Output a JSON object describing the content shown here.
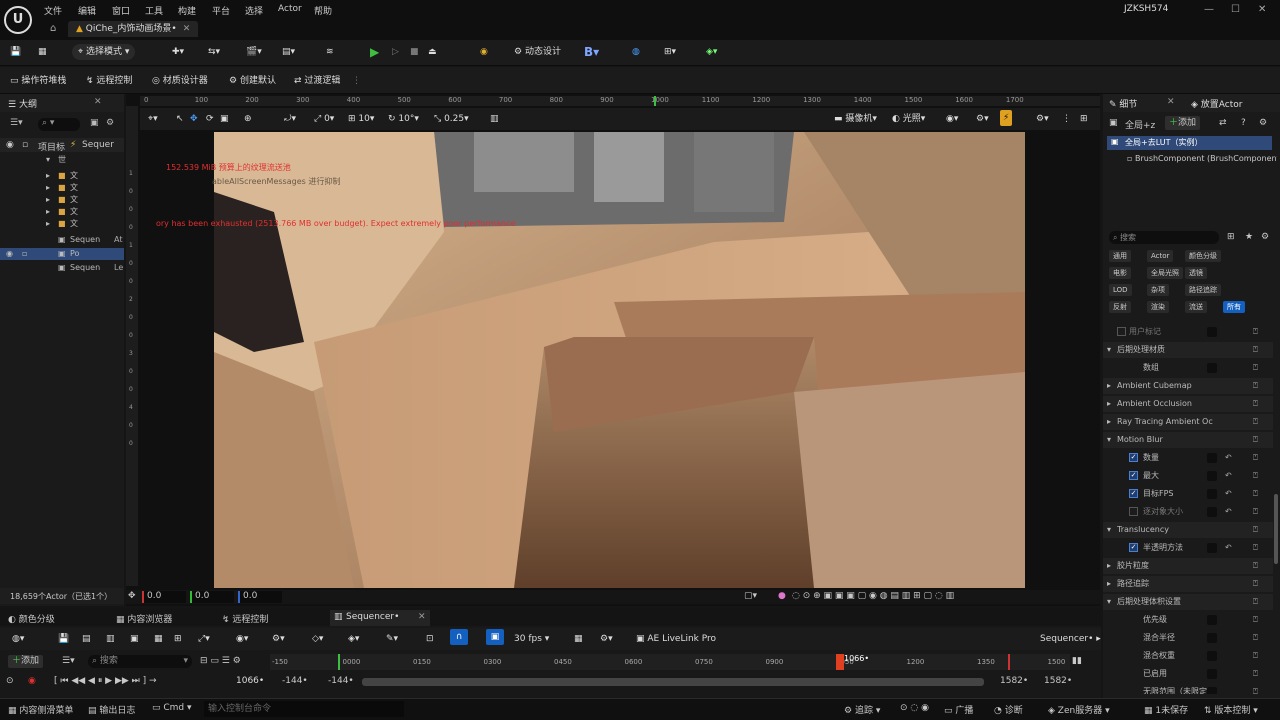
{
  "app": {
    "menus": [
      "文件",
      "编辑",
      "窗口",
      "工具",
      "构建",
      "平台",
      "选择",
      "Actor",
      "帮助"
    ],
    "user": "JZKSH574",
    "level_tab": "QiChe_内饰动画场景•"
  },
  "toolbar": {
    "mode": "选择模式",
    "dynamic": "动态设计"
  },
  "toolbar2": [
    "操作符堆栈",
    "远程控制",
    "材质设计器",
    "创建默认",
    "过渡逻辑"
  ],
  "outliner": {
    "title": "大纲",
    "col_label": "项目标",
    "col_type": "Sequer",
    "items": [
      {
        "label": "世",
        "indent": 3
      },
      {
        "label": "文",
        "indent": 4
      },
      {
        "label": "文",
        "indent": 4
      },
      {
        "label": "文",
        "indent": 4
      },
      {
        "label": "文",
        "indent": 4
      },
      {
        "label": "文",
        "indent": 4
      },
      {
        "label": "Sequen",
        "indent": 4,
        "type": "At"
      },
      {
        "label": "Po",
        "indent": 4,
        "selected": true
      },
      {
        "label": "Sequen",
        "indent": 4,
        "type": "Le"
      }
    ],
    "footer": "18,659个Actor（已选1个）"
  },
  "viewport": {
    "ruler": [
      "0",
      "100",
      "200",
      "300",
      "400",
      "500",
      "600",
      "700",
      "800",
      "900",
      "1000",
      "1100",
      "1200",
      "1300",
      "1400",
      "1500",
      "1600",
      "1700"
    ],
    "left_ruler": [
      "1",
      "0",
      "0",
      "0",
      "1",
      "0",
      "0",
      "2",
      "0",
      "0",
      "3",
      "0",
      "0",
      "4",
      "0",
      "0"
    ],
    "tools": {
      "grid": "0",
      "angle": "10",
      "rot": "10°",
      "scale": "0.25"
    },
    "camera": "摄像机",
    "lighting": "光照",
    "msg1": "152.539 MiB 预算上的纹理流送池",
    "msg2": "ableAllScreenMessages 进行抑制",
    "msg3": "ory has been exhausted (2513.766 MB over budget). Expect extremely poor performance",
    "coords": [
      "0.0",
      "0.0",
      "0.0"
    ]
  },
  "details": {
    "tab1": "细节",
    "tab2": "放置Actor",
    "component_label": "全局+z",
    "add": "添加",
    "actor": "全局+去LUT（实例）",
    "brush": "BrushComponent (BrushComponent)",
    "search": "搜索",
    "filters": [
      [
        "通用",
        "Actor",
        "颜色分级"
      ],
      [
        "电影",
        "全局光照",
        "透镜"
      ],
      [
        "LOD",
        "杂项",
        "路径追踪"
      ],
      [
        "反射",
        "渲染",
        "流送",
        "所有"
      ]
    ],
    "props": [
      {
        "label": "用户标记",
        "type": "item"
      },
      {
        "label": "后期处理材质",
        "type": "group"
      },
      {
        "label": "数组",
        "type": "item"
      },
      {
        "label": "Ambient Cubemap",
        "type": "group-closed"
      },
      {
        "label": "Ambient Occlusion",
        "type": "group-closed"
      },
      {
        "label": "Ray Tracing Ambient Oc",
        "type": "group-closed"
      },
      {
        "label": "Motion Blur",
        "type": "group"
      },
      {
        "label": "数量",
        "type": "check"
      },
      {
        "label": "最大",
        "type": "check"
      },
      {
        "label": "目标FPS",
        "type": "check"
      },
      {
        "label": "逐对象大小",
        "type": "check-off"
      },
      {
        "label": "Translucency",
        "type": "group"
      },
      {
        "label": "半透明方法",
        "type": "check"
      },
      {
        "label": "胶片粒度",
        "type": "group-closed"
      },
      {
        "label": "路径追踪",
        "type": "group-closed"
      },
      {
        "label": "后期处理体积设置",
        "type": "group"
      },
      {
        "label": "优先级",
        "type": "item"
      },
      {
        "label": "混合半径",
        "type": "item"
      },
      {
        "label": "混合权重",
        "type": "item"
      },
      {
        "label": "已启用",
        "type": "item"
      },
      {
        "label": "无限范围（未限定）",
        "type": "item"
      }
    ]
  },
  "seq": {
    "tabs": [
      "颜色分级",
      "内容浏览器",
      "远程控制",
      "Sequencer•"
    ],
    "add": "添加",
    "search": "搜索",
    "fps": "30 fps",
    "livelink": "AE LiveLink Pro",
    "seq_name": "Sequencer•",
    "timeline": [
      "-150",
      "0000",
      "0150",
      "0300",
      "0450",
      "0600",
      "0750",
      "0900",
      "1050",
      "1200",
      "1350",
      "1500"
    ],
    "current": "1066•",
    "start1": "-144•",
    "start2": "-144•",
    "end1": "1582•",
    "end2": "1582•"
  },
  "status": {
    "items": [
      "内容侧滑菜单",
      "输出日志",
      "Cmd"
    ],
    "cmd_placeholder": "输入控制台命令",
    "right": [
      "追踪",
      "广播",
      "诊断",
      "Zen服务器",
      "1未保存",
      "版本控制"
    ]
  }
}
